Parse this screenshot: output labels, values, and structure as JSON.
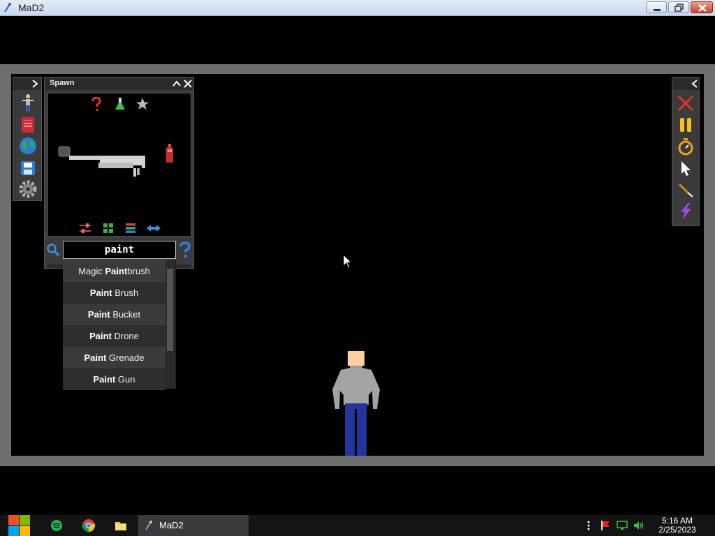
{
  "window": {
    "title": "MaD2"
  },
  "left_toolbar": {
    "items": [
      "character-icon",
      "book-icon",
      "globe-icon",
      "save-icon",
      "settings-gear-icon"
    ]
  },
  "spawn": {
    "title": "Spawn",
    "category_icons": [
      "help-question-icon",
      "flask-icon",
      "star-icon"
    ],
    "bottom_icons": [
      "sliders-icon",
      "grid-icon",
      "list-icon",
      "swap-arrows-icon"
    ],
    "search": {
      "value": "paint"
    }
  },
  "results": [
    {
      "pre": "Magic ",
      "bold": "Paint",
      "post": "brush"
    },
    {
      "pre": "",
      "bold": "Paint",
      "post": " Brush"
    },
    {
      "pre": "",
      "bold": "Paint",
      "post": " Bucket"
    },
    {
      "pre": "",
      "bold": "Paint",
      "post": " Drone"
    },
    {
      "pre": "",
      "bold": "Paint",
      "post": " Grenade"
    },
    {
      "pre": "",
      "bold": "Paint",
      "post": " Gun"
    }
  ],
  "right_toolbar": {
    "items": [
      "clear-x-icon",
      "pause-icon",
      "stopwatch-icon",
      "pointer-icon",
      "knife-icon",
      "lightning-icon"
    ]
  },
  "taskbar": {
    "app_label": "MaD2",
    "clock_time": "5:16 AM",
    "clock_date": "2/25/2023"
  },
  "colors": {
    "canvas_bg": "#000000",
    "frame_gray": "#6e6e6e",
    "accent_blue": "#2f7fd6",
    "red_x": "#d9342b",
    "pause_yellow": "#f3c21c"
  }
}
